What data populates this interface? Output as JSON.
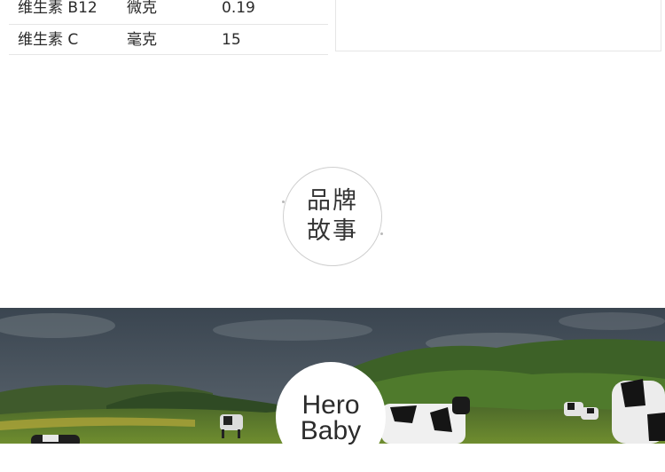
{
  "nutrition": {
    "rows": [
      {
        "name": "维生素 B12",
        "unit": "微克",
        "value": "0.19"
      },
      {
        "name": "维生素 C",
        "unit": "毫克",
        "value": "15"
      }
    ]
  },
  "brand_story": {
    "line1": "品牌",
    "line2": "故事"
  },
  "banner": {
    "hero_line1": "Hero",
    "hero_line2": "Baby",
    "sky_color": "#3f4a55",
    "grass_color": "#5e7a2c"
  }
}
